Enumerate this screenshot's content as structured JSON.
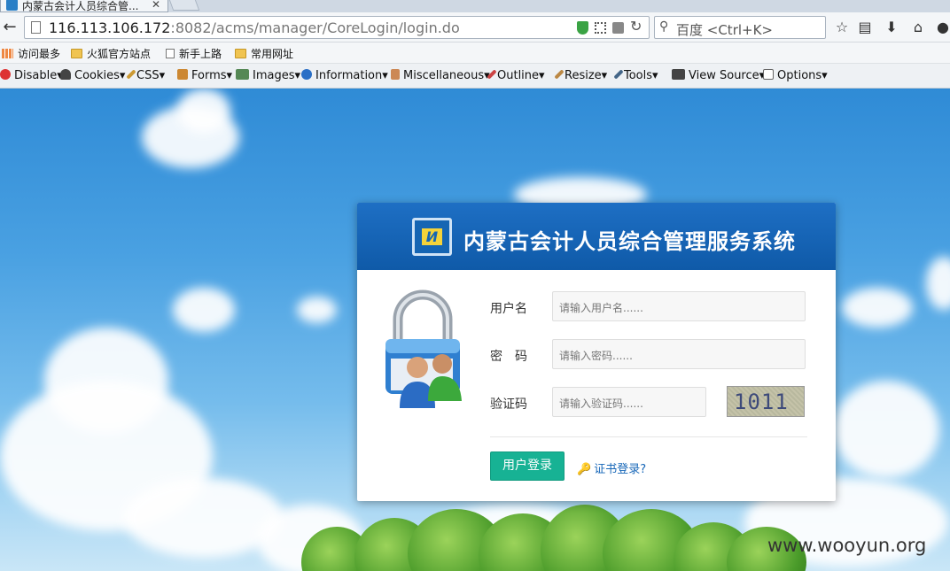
{
  "browser": {
    "tab_title": "内蒙古会计人员综合管...",
    "url_host": "116.113.106.172",
    "url_rest": ":8082/acms/manager/CoreLogin/login.do",
    "search_placeholder": "百度 <Ctrl+K>",
    "bookmarks": [
      {
        "label": "访问最多",
        "icon": "apps-grid-icon"
      },
      {
        "label": "火狐官方站点",
        "icon": "folder-icon"
      },
      {
        "label": "新手上路",
        "icon": "page-icon"
      },
      {
        "label": "常用网址",
        "icon": "folder-icon"
      }
    ],
    "devbar": [
      {
        "label": "Disable",
        "icon": "disable-icon",
        "color": "#d33"
      },
      {
        "label": "Cookies",
        "icon": "cookies-icon",
        "color": "#444"
      },
      {
        "label": "CSS",
        "icon": "css-icon",
        "color": "#c93"
      },
      {
        "label": "Forms",
        "icon": "forms-icon",
        "color": "#c83"
      },
      {
        "label": "Images",
        "icon": "images-icon",
        "color": "#585"
      },
      {
        "label": "Information",
        "icon": "information-icon",
        "color": "#2a6fc6"
      },
      {
        "label": "Miscellaneous",
        "icon": "miscellaneous-icon",
        "color": "#c85"
      },
      {
        "label": "Outline",
        "icon": "outline-icon",
        "color": "#c44"
      },
      {
        "label": "Resize",
        "icon": "resize-icon",
        "color": "#b84"
      },
      {
        "label": "Tools",
        "icon": "tools-icon",
        "color": "#468"
      },
      {
        "label": "View Source",
        "icon": "view-source-icon",
        "color": "#444"
      },
      {
        "label": "Options",
        "icon": "options-icon",
        "color": "#666"
      }
    ]
  },
  "login": {
    "title": "内蒙古会计人员综合管理服务系统",
    "logo_text": "И",
    "username_label": "用户名",
    "username_placeholder": "请输入用户名......",
    "password_label": "密　码",
    "password_placeholder": "请输入密码......",
    "captcha_label": "验证码",
    "captcha_placeholder": "请输入验证码......",
    "captcha_value": "1011",
    "login_button": "用户登录",
    "cert_link": "证书登录?"
  },
  "watermark": "www.wooyun.org",
  "colors": {
    "header_blue": "#1565b3",
    "login_button": "#17b294",
    "link": "#1767b8"
  }
}
